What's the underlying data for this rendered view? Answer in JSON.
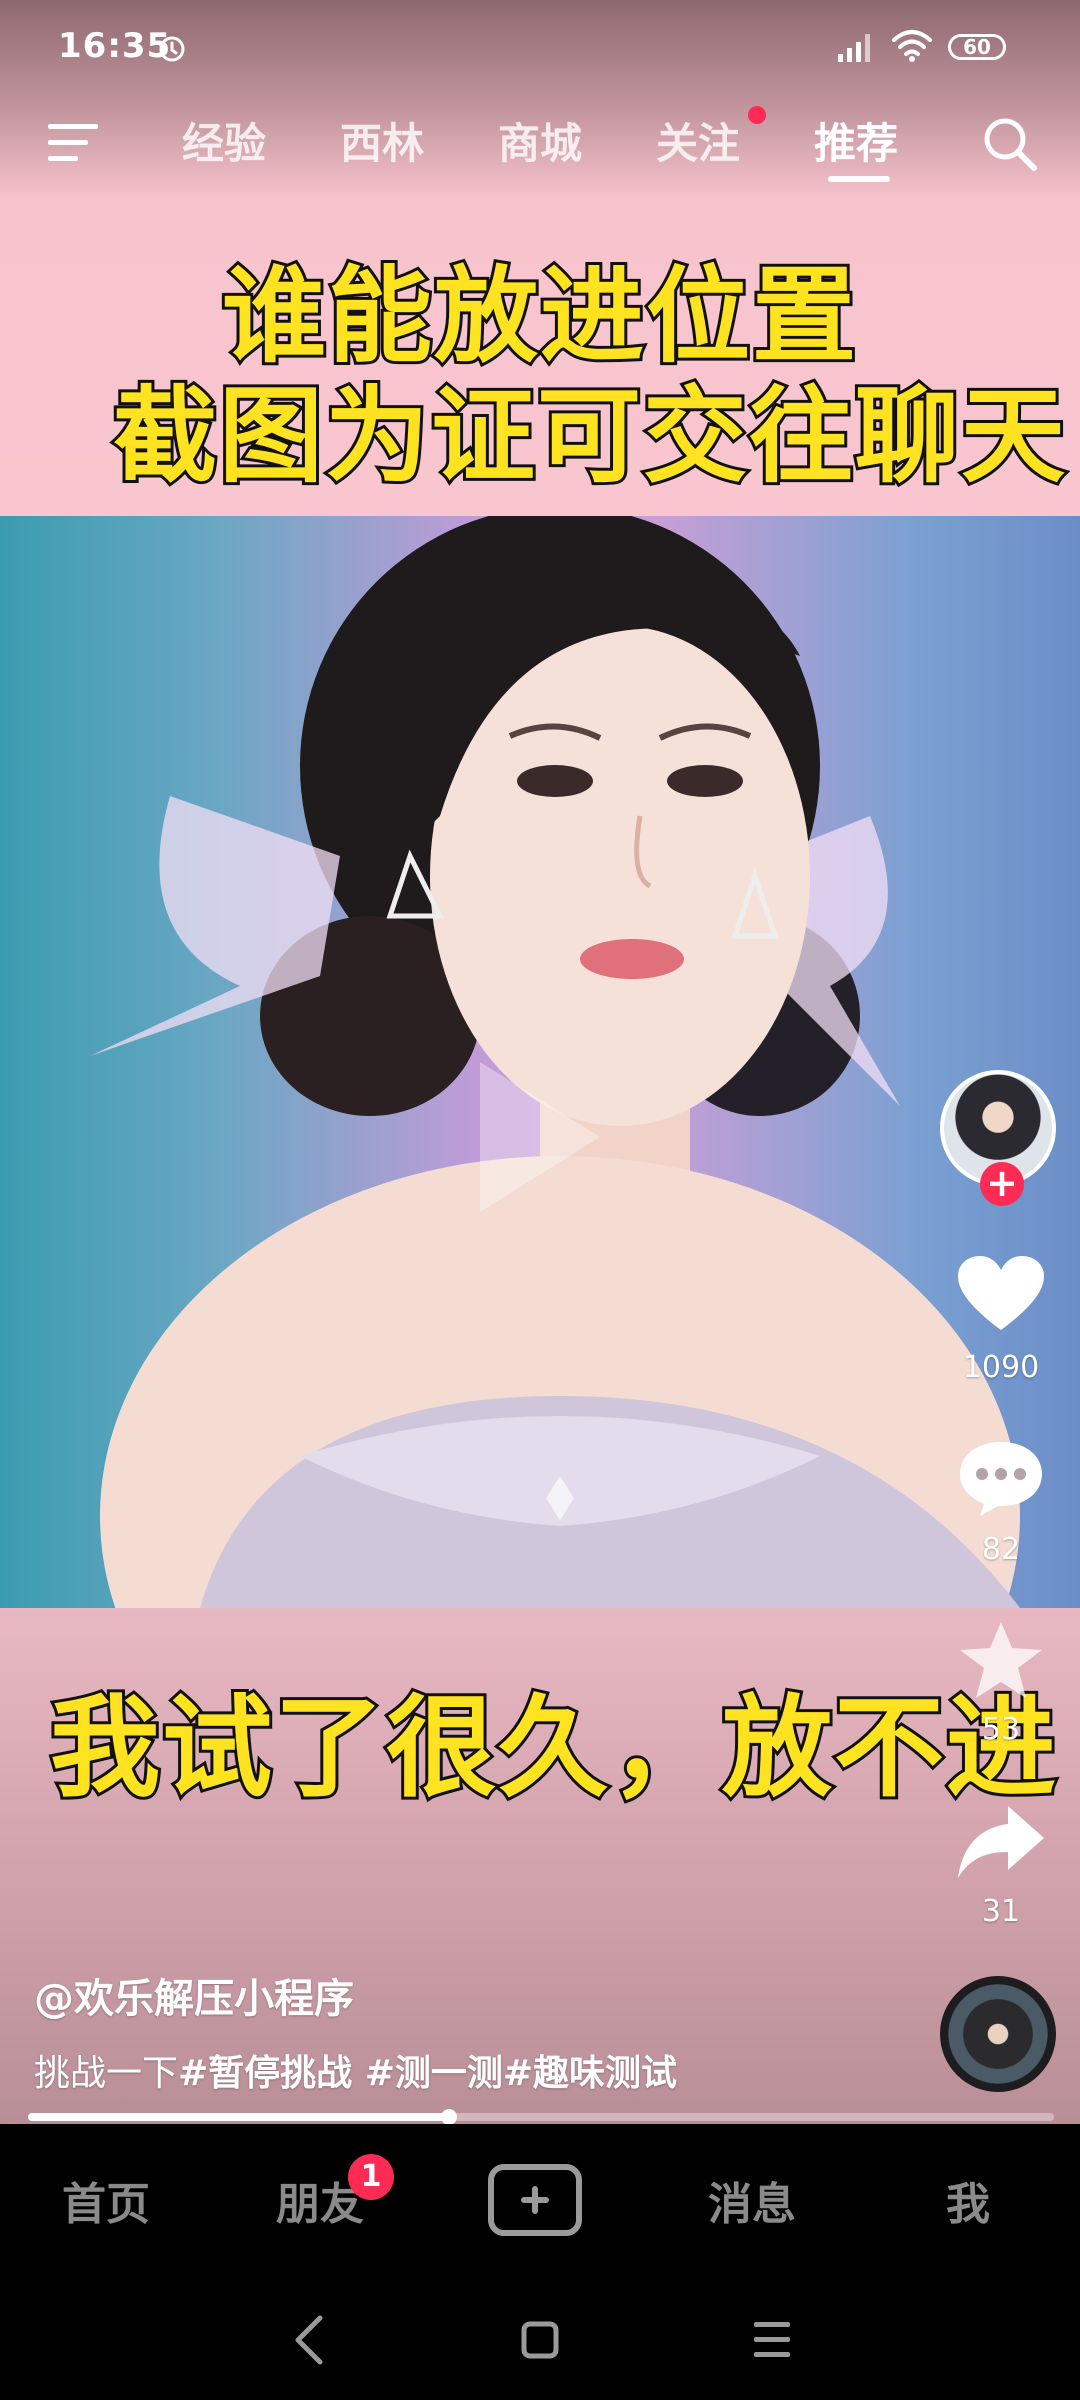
{
  "status_bar": {
    "time": "16:35",
    "battery": "60",
    "icons": [
      "alarm-icon",
      "signal-icon",
      "wifi-icon",
      "battery-icon"
    ]
  },
  "top_nav": {
    "tabs": [
      {
        "label": "经验"
      },
      {
        "label": "西林"
      },
      {
        "label": "商城"
      },
      {
        "label": "关注"
      },
      {
        "label": "推荐"
      }
    ],
    "active_tab": "推荐",
    "icons": [
      "menu-icon",
      "search-icon"
    ]
  },
  "video": {
    "headline_line1": "谁能放进位置",
    "headline_line2": "截图为证可交往聊天",
    "caption": "我试了很久，放不进",
    "author": "@欢乐解压小程序",
    "description_prefix": "挑战一下",
    "description_tags": "#暂停挑战 #测一测#趣味测试",
    "progress": 0.41
  },
  "side_actions": {
    "likes": "1090",
    "comments": "82",
    "favorites": "53",
    "shares": "31"
  },
  "tab_bar": {
    "home": "首页",
    "friends": "朋友",
    "friends_badge": "1",
    "messages": "消息",
    "me": "我"
  },
  "colors": {
    "accent": "#fe2c55",
    "caption_yellow": "#ffe321"
  }
}
